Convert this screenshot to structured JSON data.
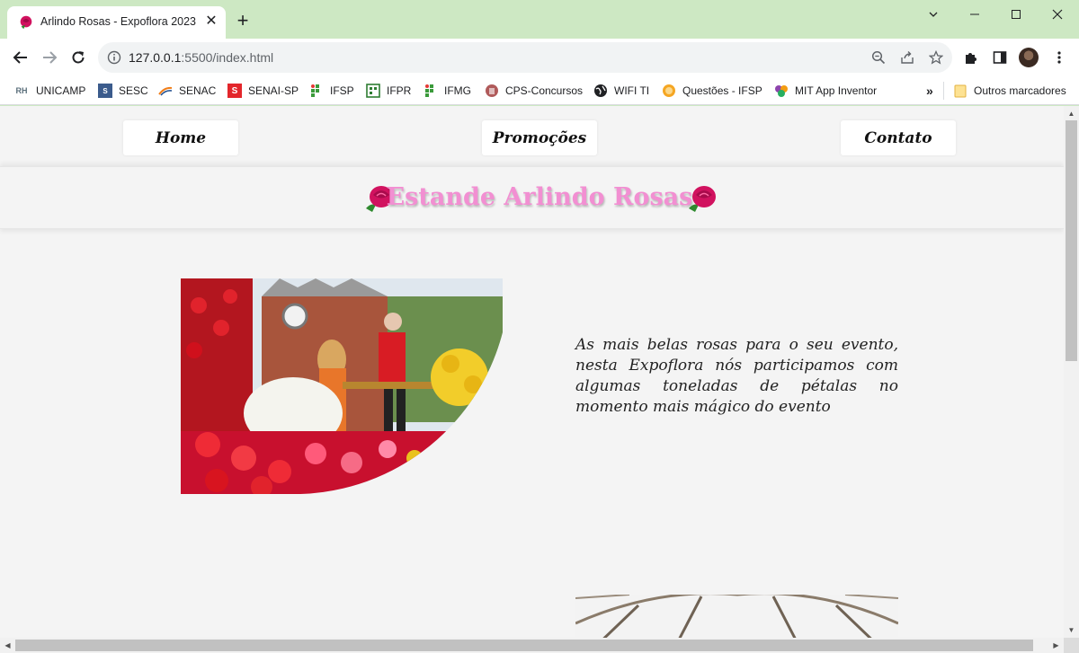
{
  "browser": {
    "tab": {
      "title": "Arlindo Rosas - Expoflora 2023",
      "close_label": "✕",
      "favicon": "rose-icon"
    },
    "new_tab_label": "+",
    "window_controls": [
      "chevron-down-icon",
      "minimize-icon",
      "maximize-icon",
      "close-icon"
    ],
    "url": {
      "host": "127.0.0.1",
      "rest": ":5500/index.html"
    },
    "bookmarks": [
      {
        "label": "UNICAMP",
        "icon": "unicamp-icon"
      },
      {
        "label": "SESC",
        "icon": "sesc-icon"
      },
      {
        "label": "SENAC",
        "icon": "senac-icon"
      },
      {
        "label": "SENAI-SP",
        "icon": "senai-icon"
      },
      {
        "label": "IFSP",
        "icon": "if-icon"
      },
      {
        "label": "IFPR",
        "icon": "if-icon"
      },
      {
        "label": "IFMG",
        "icon": "if-icon"
      },
      {
        "label": "CPS-Concursos",
        "icon": "cps-icon"
      },
      {
        "label": "WIFI TI",
        "icon": "globe-icon"
      },
      {
        "label": "Questões - IFSP",
        "icon": "questoes-icon"
      },
      {
        "label": "MIT App Inventor",
        "icon": "mit-icon"
      }
    ],
    "bookmarks_overflow_label": "»",
    "other_bookmarks_label": "Outros marcadores"
  },
  "page": {
    "nav": {
      "home": "Home",
      "promocoes": "Promoções",
      "contato": "Contato"
    },
    "title": "Estande Arlindo Rosas",
    "description": "As mais belas rosas para o seu evento, nesta Expoflora nós participamos com algumas toneladas de pétalas no momento mais mágico do evento"
  },
  "colors": {
    "title": "#f28fd2",
    "tabbar": "#cde8c3",
    "page_bg": "#f4f4f4"
  }
}
